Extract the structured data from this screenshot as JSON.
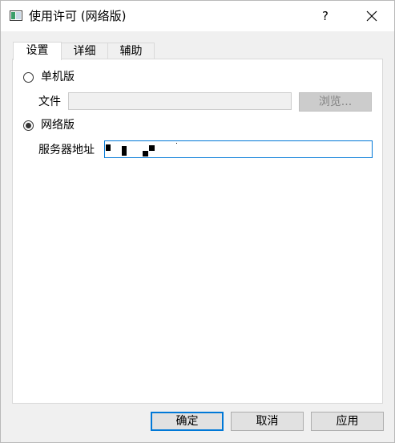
{
  "window": {
    "title": "使用许可 (网络版)",
    "help_label": "?",
    "icons": {
      "app": "app-window-icon",
      "close": "close-icon"
    }
  },
  "tabs": [
    {
      "label": "设置",
      "active": true
    },
    {
      "label": "详细",
      "active": false
    },
    {
      "label": "辅助",
      "active": false
    }
  ],
  "settings": {
    "standalone": {
      "label": "单机版",
      "checked": false
    },
    "file": {
      "label": "文件",
      "value": "",
      "browse_label": "浏览..."
    },
    "network": {
      "label": "网络版",
      "checked": true
    },
    "server": {
      "label": "服务器地址"
    }
  },
  "buttons": {
    "ok": "确定",
    "cancel": "取消",
    "apply": "应用"
  },
  "colors": {
    "accent": "#0078d7",
    "dialog_background": "#f0f0f0",
    "disabled_text": "#838383"
  }
}
